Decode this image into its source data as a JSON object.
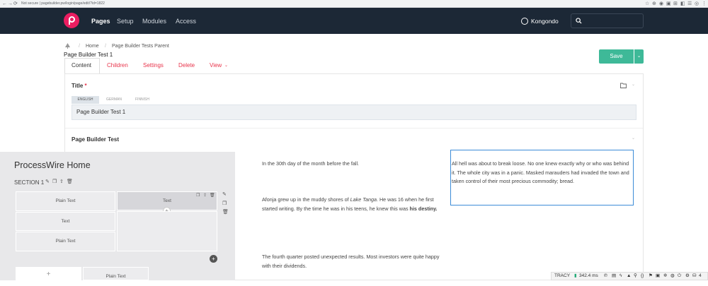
{
  "browser": {
    "nav": [
      "←",
      "→",
      "⟳",
      "⌂"
    ],
    "url": "Not secure | pagebuilder.pw/login/page/edit/?id=1822",
    "extensions": [
      "☆",
      "⊕",
      "◉",
      "▣",
      "⊞",
      "◧",
      "☰",
      "◐",
      "◎",
      "⋮"
    ]
  },
  "topbar": {
    "menu": [
      "Pages",
      "Setup",
      "Modules",
      "Access"
    ],
    "user": "Kongondo",
    "search_placeholder": ""
  },
  "breadcrumb": {
    "items": [
      "Home",
      "Page Builder Tests Parent"
    ]
  },
  "page_title": "Page Builder Test 1",
  "save_label": "Save",
  "tabs": [
    "Content",
    "Children",
    "Settings",
    "Delete",
    "View"
  ],
  "title_field": {
    "label": "Title",
    "required": "*",
    "languages": [
      "ENGLISH",
      "GERMAN",
      "FINNISH"
    ],
    "value": "Page Builder Test 1"
  },
  "pagebuilder_field": {
    "label": "Page Builder Test"
  },
  "panel": {
    "title": "ProcessWire Home",
    "section": "SECTION 1",
    "cells": {
      "a": "Plain Text",
      "b": "Text",
      "c": "Plain Text",
      "d": "Text",
      "e": "+",
      "f": "Plain Text",
      "g": "+"
    }
  },
  "content": {
    "p1": "In the 30th day of the month before the fall.",
    "p2_a": "Afonja grew up in the muddy shores of ",
    "p2_em": "Lake Tanga",
    "p2_b": ". He was 16 when he first started writing. By the time he was in his teens, he knew this was ",
    "p2_strong": "his destiny.",
    "p3": "The fourth quarter posted unexpected results. Most investors were quite happy with their dividends.",
    "selected": "All hell was about to break loose. No one knew exactly why or who was behind it. The whole city was in a panic. Masked marauders had invaded the town and taken control of their most precious commodity; bread."
  },
  "tracy": {
    "label": "TRACY",
    "time": "342.4 ms",
    "count": "4"
  },
  "colors": {
    "brand": "#eb1d61",
    "topbar": "#1c2836",
    "save": "#3eb998",
    "tab": "#e8334a",
    "selection": "#3c8cd7"
  }
}
